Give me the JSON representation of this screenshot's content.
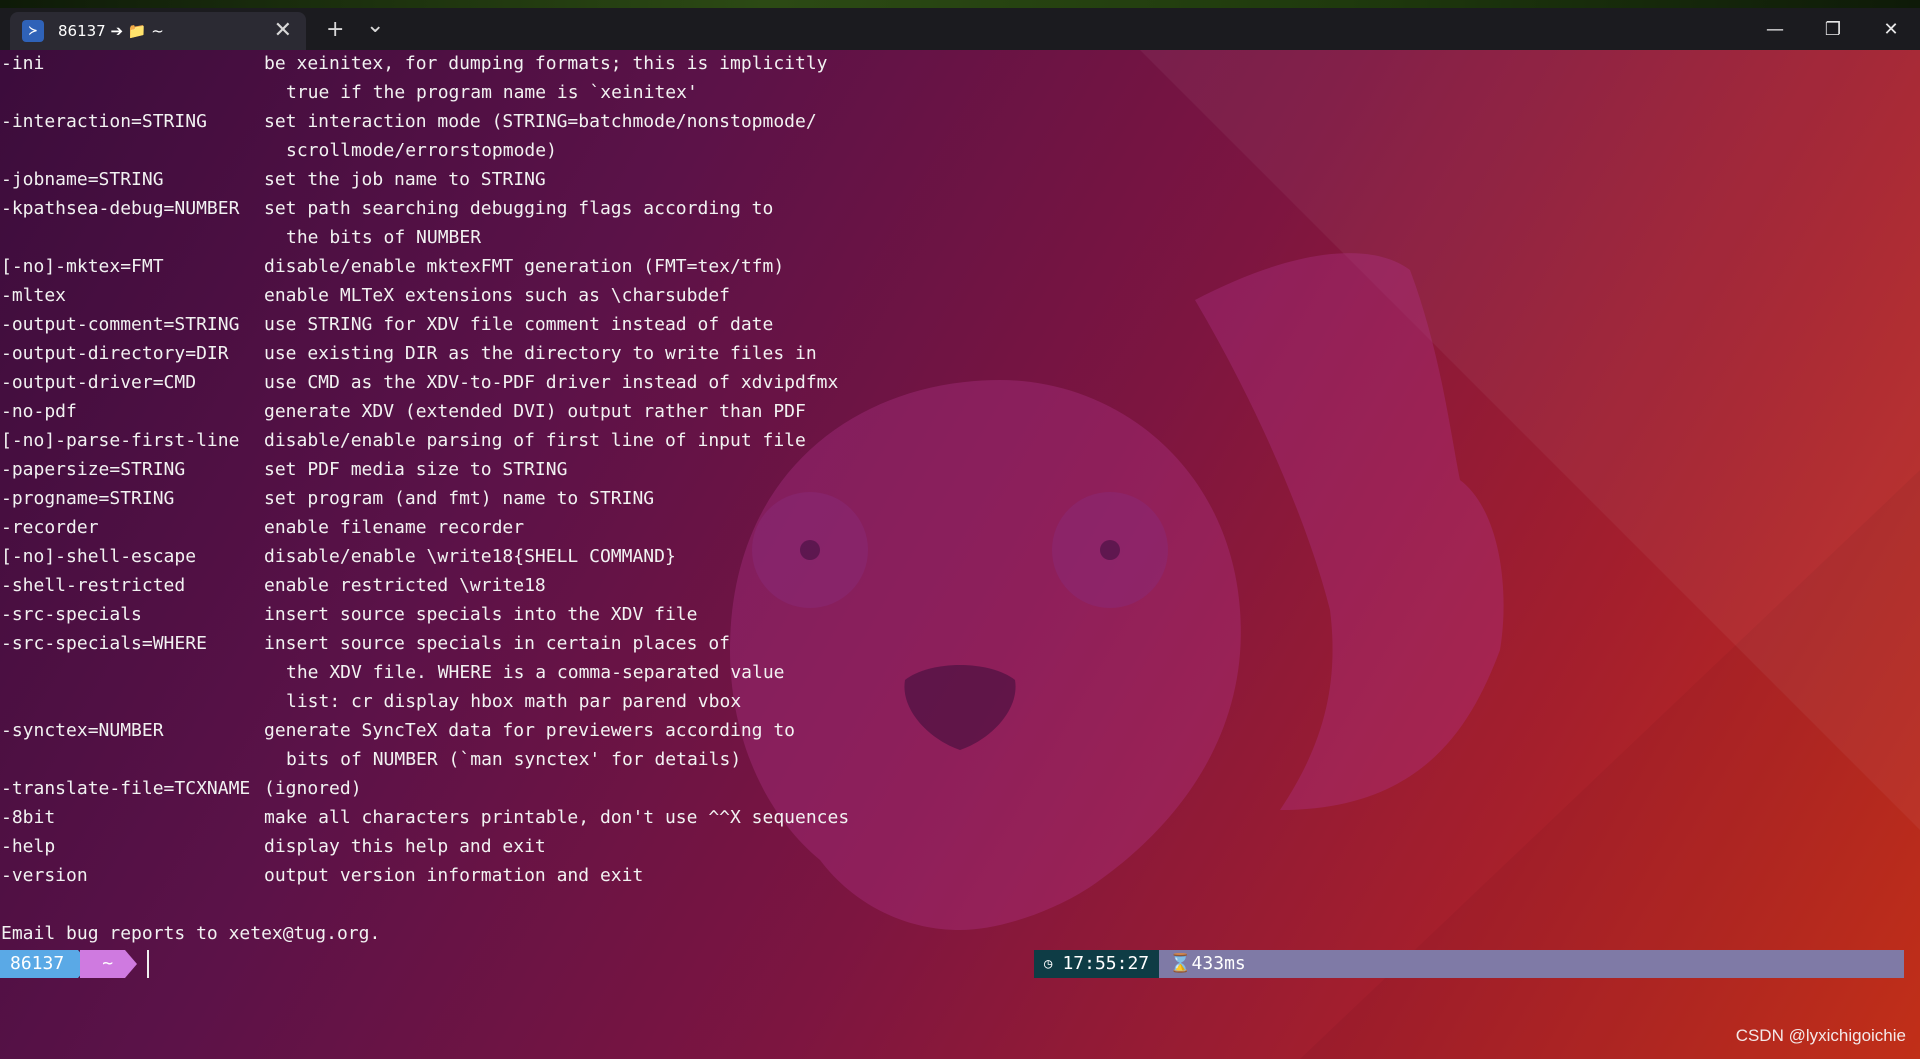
{
  "tab": {
    "title": "86137 ➔ 📁 ~",
    "icon": "powershell-icon",
    "close": "✕"
  },
  "toolbar": {
    "new_tab": "+",
    "dropdown": "⌄"
  },
  "window": {
    "minimize": "—",
    "restore": "❐",
    "close": "✕"
  },
  "terminal": {
    "lines": [
      {
        "opt": "-ini",
        "desc": "be xeinitex, for dumping formats; this is implicitly"
      },
      {
        "cont": "true if the program name is `xeinitex'"
      },
      {
        "opt": "-interaction=STRING",
        "desc": "set interaction mode (STRING=batchmode/nonstopmode/"
      },
      {
        "cont": "scrollmode/errorstopmode)"
      },
      {
        "opt": "-jobname=STRING",
        "desc": "set the job name to STRING"
      },
      {
        "opt": "-kpathsea-debug=NUMBER",
        "desc": "set path searching debugging flags according to"
      },
      {
        "cont": "the bits of NUMBER"
      },
      {
        "opt": "[-no]-mktex=FMT",
        "desc": "disable/enable mktexFMT generation (FMT=tex/tfm)"
      },
      {
        "opt": "-mltex",
        "desc": "enable MLTeX extensions such as \\charsubdef"
      },
      {
        "opt": "-output-comment=STRING",
        "desc": "use STRING for XDV file comment instead of date"
      },
      {
        "opt": "-output-directory=DIR",
        "desc": "use existing DIR as the directory to write files in"
      },
      {
        "opt": "-output-driver=CMD",
        "desc": "use CMD as the XDV-to-PDF driver instead of xdvipdfmx"
      },
      {
        "opt": "-no-pdf",
        "desc": "generate XDV (extended DVI) output rather than PDF"
      },
      {
        "opt": "[-no]-parse-first-line",
        "desc": "disable/enable parsing of first line of input file"
      },
      {
        "opt": "-papersize=STRING",
        "desc": "set PDF media size to STRING"
      },
      {
        "opt": "-progname=STRING",
        "desc": "set program (and fmt) name to STRING"
      },
      {
        "opt": "-recorder",
        "desc": "enable filename recorder"
      },
      {
        "opt": "[-no]-shell-escape",
        "desc": "disable/enable \\write18{SHELL COMMAND}"
      },
      {
        "opt": "-shell-restricted",
        "desc": "enable restricted \\write18"
      },
      {
        "opt": "-src-specials",
        "desc": "insert source specials into the XDV file"
      },
      {
        "opt": "-src-specials=WHERE",
        "desc": "insert source specials in certain places of"
      },
      {
        "cont": "the XDV file. WHERE is a comma-separated value"
      },
      {
        "cont": "list: cr display hbox math par parend vbox"
      },
      {
        "opt": "-synctex=NUMBER",
        "desc": "generate SyncTeX data for previewers according to"
      },
      {
        "cont": "bits of NUMBER (`man synctex' for details)"
      },
      {
        "opt": "-translate-file=TCXNAME",
        "desc": "(ignored)"
      },
      {
        "opt": "-8bit",
        "desc": "make all characters printable, don't use ^^X sequences"
      },
      {
        "opt": "-help",
        "desc": "display this help and exit"
      },
      {
        "opt": "-version",
        "desc": "output version information and exit"
      },
      {
        "opt": ""
      },
      {
        "opt": "Email bug reports to xetex@tug.org."
      }
    ]
  },
  "prompt": {
    "user": "86137",
    "path": "~"
  },
  "status": {
    "clock_icon": "◷",
    "time": "17:55:27",
    "duration": "⌛433ms"
  },
  "watermark": "CSDN @lyxichigoichie",
  "colors": {
    "user_segment": "#5aa9e6",
    "path_segment": "#cf7ae0",
    "time_segment": "#0e3c45",
    "duration_segment": "#7f7aa6"
  }
}
